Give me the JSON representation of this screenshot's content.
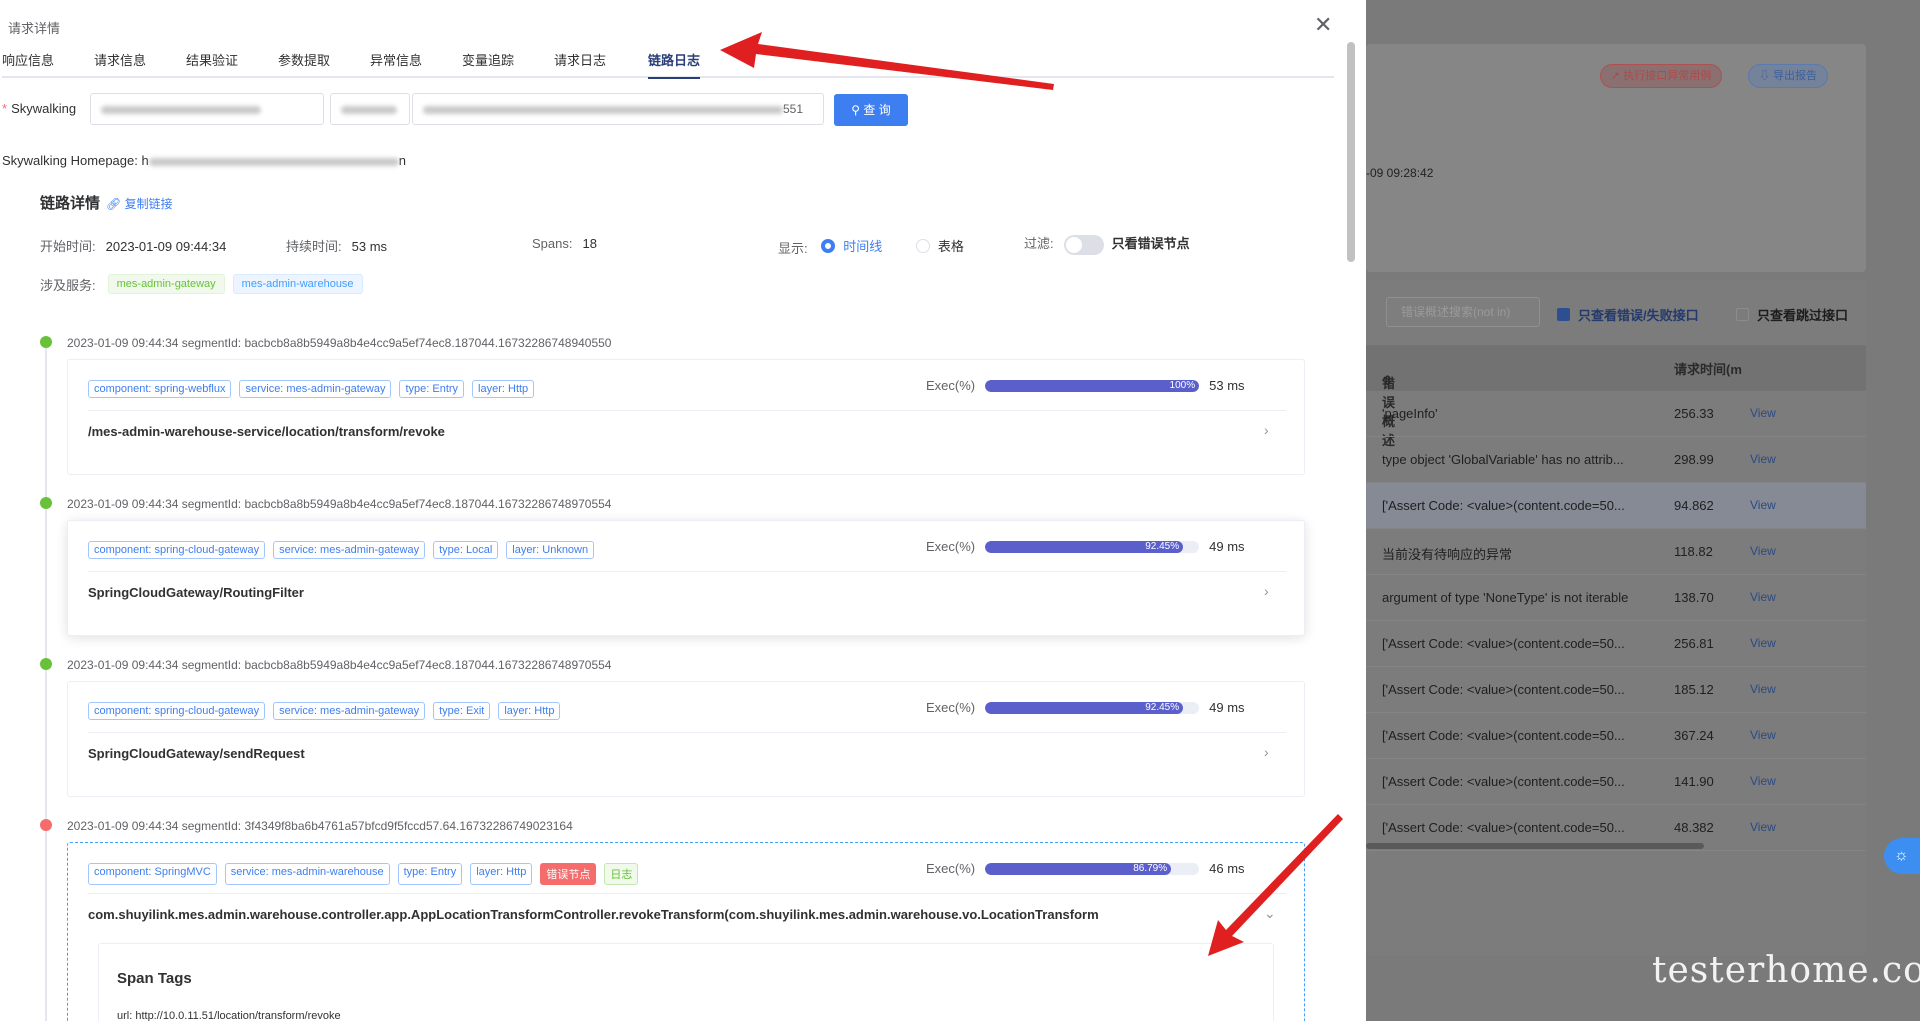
{
  "dialog": {
    "title": "请求详情",
    "close_icon": "close-icon",
    "tabs": [
      {
        "label": "响应信息"
      },
      {
        "label": "请求信息"
      },
      {
        "label": "结果验证"
      },
      {
        "label": "参数提取"
      },
      {
        "label": "异常信息"
      },
      {
        "label": "变量追踪"
      },
      {
        "label": "请求日志"
      },
      {
        "label": "链路日志",
        "active": true
      }
    ]
  },
  "skywalking": {
    "required_mark": "*",
    "label": "Skywalking",
    "input3_suffix": "551",
    "query_button": "查 询",
    "homepage_label": "Skywalking Homepage: h",
    "homepage_suffix": "n"
  },
  "trace": {
    "title": "链路详情",
    "copy_link": "复制链接",
    "start_label": "开始时间:",
    "start_value": "2023-01-09 09:44:34",
    "duration_label": "持续时间:",
    "duration_value": "53 ms",
    "spans_label": "Spans:",
    "spans_value": "18",
    "display_label": "显示:",
    "display_options": [
      "时间线",
      "表格"
    ],
    "filter_label": "过滤:",
    "filter_option": "只看错误节点",
    "services_label": "涉及服务:",
    "services": [
      "mes-admin-gateway",
      "mes-admin-warehouse"
    ]
  },
  "segments": [
    {
      "status": "ok",
      "header": "2023-01-09 09:44:34 segmentId: bacbcb8a8b5949a8b4e4cc9a5ef74ec8.187044.16732286748940550",
      "tags": [
        "component: spring-webflux",
        "service: mes-admin-gateway",
        "type: Entry",
        "layer: Http"
      ],
      "exec_label": "Exec(%)",
      "exec_pct": 100,
      "exec_text": "100%",
      "exec_ms": "53 ms",
      "operation": "/mes-admin-warehouse-service/location/transform/revoke"
    },
    {
      "status": "ok",
      "header": "2023-01-09 09:44:34 segmentId: bacbcb8a8b5949a8b4e4cc9a5ef74ec8.187044.16732286748970554",
      "tags": [
        "component: spring-cloud-gateway",
        "service: mes-admin-gateway",
        "type: Local",
        "layer: Unknown"
      ],
      "exec_label": "Exec(%)",
      "exec_pct": 92.45,
      "exec_text": "92.45%",
      "exec_ms": "49 ms",
      "operation": "SpringCloudGateway/RoutingFilter"
    },
    {
      "status": "ok",
      "header": "2023-01-09 09:44:34 segmentId: bacbcb8a8b5949a8b4e4cc9a5ef74ec8.187044.16732286748970554",
      "tags": [
        "component: spring-cloud-gateway",
        "service: mes-admin-gateway",
        "type: Exit",
        "layer: Http"
      ],
      "exec_label": "Exec(%)",
      "exec_pct": 92.45,
      "exec_text": "92.45%",
      "exec_ms": "49 ms",
      "operation": "SpringCloudGateway/sendRequest"
    },
    {
      "status": "error",
      "header": "2023-01-09 09:44:34 segmentId: 3f4349f8ba6b4761a57bfcd9f5fccd57.64.16732286749023164",
      "tags": [
        "component: SpringMVC",
        "service: mes-admin-warehouse",
        "type: Entry",
        "layer: Http"
      ],
      "error_tag": "错误节点",
      "log_tag": "日志",
      "exec_label": "Exec(%)",
      "exec_pct": 86.79,
      "exec_text": "86.79%",
      "exec_ms": "46 ms",
      "operation": "com.shuyilink.mes.admin.warehouse.controller.app.AppLocationTransformController.revokeTransform(com.shuyilink.mes.admin.warehouse.vo.LocationTransform",
      "span_tags_title": "Span Tags",
      "span_tags_url": "url:   http://10.0.11.51/location/transform/revoke"
    }
  ],
  "background": {
    "btn_red": "执行接口异常用例",
    "btn_blue": "导出报告",
    "date": "-09 09:28:42",
    "search_placeholder": "错误概述搜索(not in)",
    "check1": "只查看错误/失败接口",
    "check2": "只查看跳过接口",
    "col1": "错误概述",
    "col2": "请求时间(m",
    "rows": [
      {
        "desc": "'pageInfo'",
        "time": "256.33",
        "action": "View"
      },
      {
        "desc": "type object 'GlobalVariable' has no attrib...",
        "time": "298.99",
        "action": "View"
      },
      {
        "desc": "['Assert Code: <value>(content.code=50...",
        "time": "94.862",
        "action": "View"
      },
      {
        "desc": "当前没有待响应的异常",
        "time": "118.82",
        "action": "View"
      },
      {
        "desc": "argument of type 'NoneType' is not iterable",
        "time": "138.70",
        "action": "View"
      },
      {
        "desc": "['Assert Code: <value>(content.code=50...",
        "time": "256.81",
        "action": "View"
      },
      {
        "desc": "['Assert Code: <value>(content.code=50...",
        "time": "185.12",
        "action": "View"
      },
      {
        "desc": "['Assert Code: <value>(content.code=50...",
        "time": "367.24",
        "action": "View"
      },
      {
        "desc": "['Assert Code: <value>(content.code=50...",
        "time": "141.90",
        "action": "View"
      },
      {
        "desc": "['Assert Code: <value>(content.code=50...",
        "time": "48.382",
        "action": "View"
      }
    ]
  },
  "watermark": "testerhome.com",
  "colors": {
    "primary": "#3d7ef0",
    "active_tab": "#2a3f7a",
    "bar": "#5b5fcc",
    "ok_dot": "#67c23a",
    "error_dot": "#f56c6c",
    "arrow": "#e02020"
  }
}
